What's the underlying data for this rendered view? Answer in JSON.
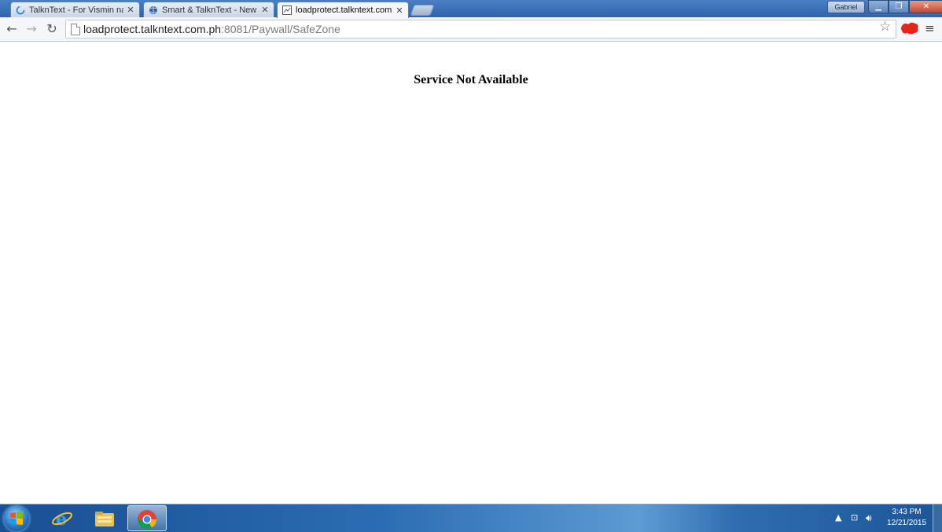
{
  "browser": {
    "tabs": [
      {
        "title": "TalknText - For Vismin na",
        "close": "✕",
        "icon": "loading-spinner-icon"
      },
      {
        "title": "Smart & TalknText - New",
        "close": "✕",
        "icon": "globe-icon"
      },
      {
        "title": "loadprotect.talkntext.com.",
        "close": "✕",
        "icon": "page-icon",
        "active": true
      }
    ],
    "profile_name": "Gabriel",
    "window_controls": {
      "minimize": "▁",
      "maximize": "❐",
      "close": "✕"
    },
    "url_host": "loadprotect.talkntext.com.ph",
    "url_path": ":8081/Paywall/SafeZone"
  },
  "page": {
    "heading": "Service Not Available"
  },
  "taskbar": {
    "apps": [
      "internet-explorer-icon",
      "file-explorer-icon",
      "chrome-icon"
    ],
    "clock_time": "3:43 PM",
    "clock_date": "12/21/2015"
  },
  "colors": {
    "taskbar_blue": "#2a6cb3",
    "tab_active": "#f4f6f9",
    "url_path_gray": "#7a7a7a"
  }
}
